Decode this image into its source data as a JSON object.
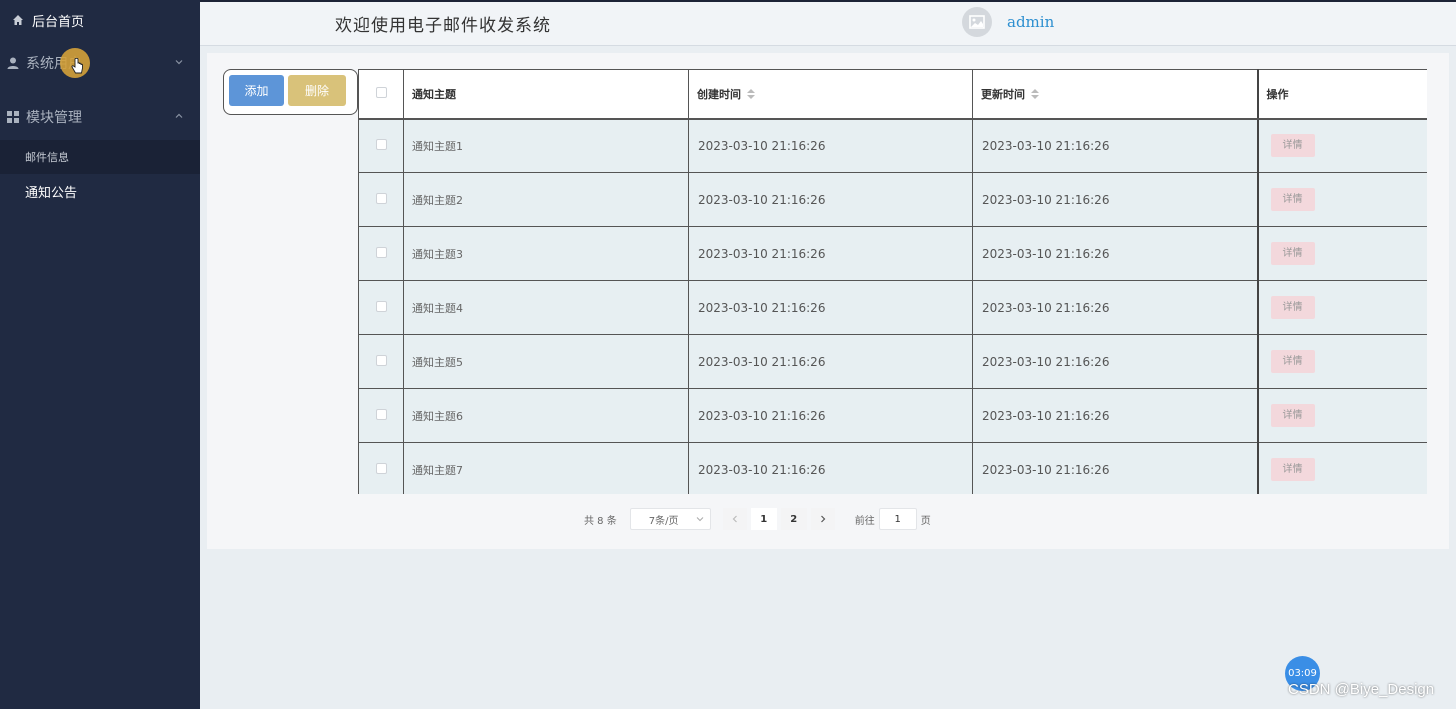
{
  "sidebar": {
    "home_label": "后台首页",
    "menus": [
      {
        "label": "系统用户"
      },
      {
        "label": "模块管理"
      }
    ],
    "submenu_items": [
      {
        "label": "邮件信息"
      },
      {
        "label": "通知公告"
      }
    ]
  },
  "header": {
    "title": "欢迎使用电子邮件收发系统",
    "username": "admin"
  },
  "toolbar": {
    "add_label": "添加",
    "delete_label": "删除"
  },
  "table": {
    "columns": [
      "通知主题",
      "创建时间",
      "更新时间",
      "操作"
    ],
    "rows": [
      {
        "subject": "通知主题1",
        "created": "2023-03-10 21:16:26",
        "updated": "2023-03-10 21:16:26",
        "action": "详情"
      },
      {
        "subject": "通知主题2",
        "created": "2023-03-10 21:16:26",
        "updated": "2023-03-10 21:16:26",
        "action": "详情"
      },
      {
        "subject": "通知主题3",
        "created": "2023-03-10 21:16:26",
        "updated": "2023-03-10 21:16:26",
        "action": "详情"
      },
      {
        "subject": "通知主题4",
        "created": "2023-03-10 21:16:26",
        "updated": "2023-03-10 21:16:26",
        "action": "详情"
      },
      {
        "subject": "通知主题5",
        "created": "2023-03-10 21:16:26",
        "updated": "2023-03-10 21:16:26",
        "action": "详情"
      },
      {
        "subject": "通知主题6",
        "created": "2023-03-10 21:16:26",
        "updated": "2023-03-10 21:16:26",
        "action": "详情"
      },
      {
        "subject": "通知主题7",
        "created": "2023-03-10 21:16:26",
        "updated": "2023-03-10 21:16:26",
        "action": "详情"
      }
    ]
  },
  "pagination": {
    "total_label": "共 8 条",
    "page_size": "7条/页",
    "pages": [
      "1",
      "2"
    ],
    "current_page": "1",
    "goto_label": "前往",
    "goto_value": "1",
    "page_unit": "页"
  },
  "overlay": {
    "timer": "03:09",
    "watermark": "CSDN @Biye_Design"
  },
  "colors": {
    "sidebar_bg": "#202a42",
    "add_button": "#5d95d8",
    "delete_button": "#d9c27a",
    "detail_button": "#f3d8dc",
    "username": "#2d8fd0"
  }
}
